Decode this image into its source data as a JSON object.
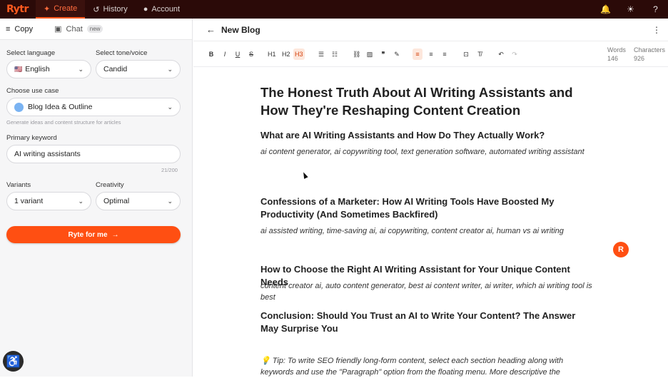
{
  "app": {
    "logo": "Rytr"
  },
  "nav": {
    "tabs": [
      {
        "label": "Create",
        "icon": "sparkle-icon"
      },
      {
        "label": "History",
        "icon": "history-icon"
      },
      {
        "label": "Account",
        "icon": "user-icon"
      }
    ]
  },
  "sidebar": {
    "tabs": {
      "copy": "Copy",
      "chat": "Chat",
      "chat_badge": "new"
    },
    "language": {
      "label": "Select language",
      "value": "English"
    },
    "tone": {
      "label": "Select tone/voice",
      "value": "Candid"
    },
    "use_case": {
      "label": "Choose use case",
      "value": "Blog Idea & Outline",
      "hint": "Generate ideas and content structure for articles"
    },
    "keyword": {
      "label": "Primary keyword",
      "value": "AI writing assistants",
      "counter": "21/200"
    },
    "variants": {
      "label": "Variants",
      "value": "1 variant"
    },
    "creativity": {
      "label": "Creativity",
      "value": "Optimal"
    },
    "ryte_button": "Ryte for me"
  },
  "document": {
    "title": "New Blog",
    "stats": {
      "words_label": "Words",
      "words": "146",
      "chars_label": "Characters",
      "chars": "926"
    },
    "toolbar": [
      "B",
      "I",
      "U",
      "S",
      "H1",
      "H2",
      "H3"
    ],
    "heading": "The Honest Truth About AI Writing Assistants and How They're Reshaping Content Creation",
    "sections": [
      {
        "h": "What are AI Writing Assistants and How Do They Actually Work?",
        "kw": "ai content generator, ai copywriting tool, text generation software, automated writing assistant"
      },
      {
        "h": "Confessions of a Marketer: How AI Writing Tools Have Boosted My Productivity (And Sometimes Backfired)",
        "kw": "ai assisted writing, time-saving ai, ai copywriting, content creator ai, human vs ai writing"
      },
      {
        "h": "How to Choose the Right AI Writing Assistant for Your Unique Content Needs",
        "kw": "content creator ai, auto content generator, best ai content writer, ai writer, which ai writing tool is best"
      },
      {
        "h": "Conclusion: Should You Trust an AI to Write Your Content? The Answer May Surprise You",
        "kw": ""
      }
    ],
    "tip": "💡 Tip: To write SEO friendly long-form content, select each section heading along with keywords and use the \"Paragraph\" option from the floating menu. More descriptive the",
    "fab": "R"
  }
}
